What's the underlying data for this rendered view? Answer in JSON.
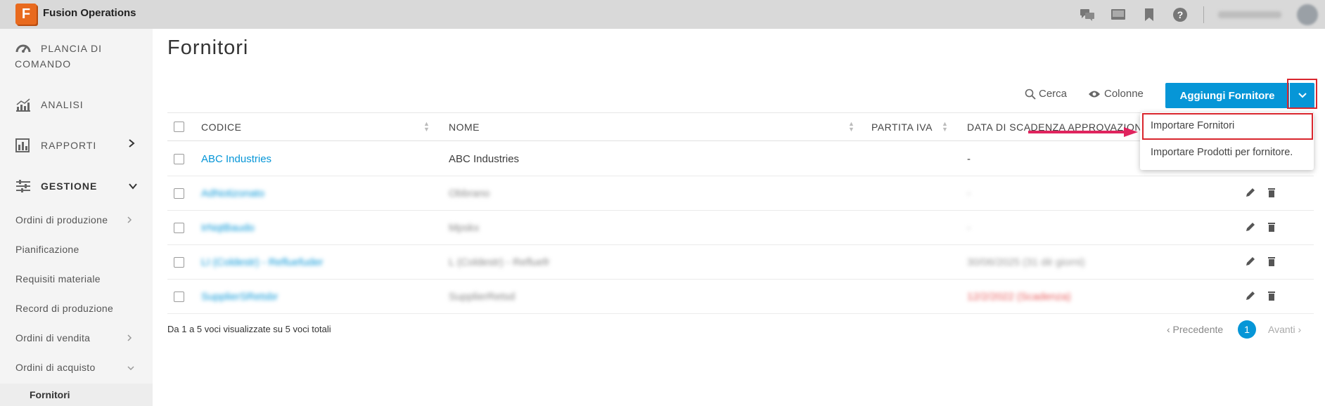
{
  "app": {
    "logo_letter": "F",
    "title": "Fusion Operations",
    "accent": "#0696d7",
    "logo_color": "#e86a1e"
  },
  "topbar": {
    "icons": [
      "chat-icon",
      "screen-icon",
      "bookmark-icon",
      "help-icon"
    ]
  },
  "sidebar": {
    "plancia_line1": "PLANCIA DI",
    "plancia_line2": "COMANDO",
    "analisi": "ANALISI",
    "rapporti": "RAPPORTI",
    "gestione": "GESTIONE",
    "sub": {
      "ordini_produzione": "Ordini di produzione",
      "pianificazione": "Pianificazione",
      "requisiti": "Requisiti materiale",
      "record": "Record di produzione",
      "ordini_vendita": "Ordini di vendita",
      "ordini_acquisto": "Ordini di acquisto",
      "fornitori": "Fornitori"
    }
  },
  "page": {
    "title": "Fornitori"
  },
  "toolbar": {
    "search": "Cerca",
    "columns": "Colonne",
    "add_button": "Aggiungi Fornitore"
  },
  "table": {
    "headers": {
      "codice": "CODICE",
      "nome": "NOME",
      "partita_iva": "PARTITA IVA",
      "scadenza": "DATA DI SCADENZA APPROVAZIONE FORNITORE"
    },
    "rows": [
      {
        "code": "ABC Industries",
        "name": "ABC Industries",
        "date": "-"
      },
      {
        "code": "AdNotizonato",
        "name": "Obbrano",
        "date": "-"
      },
      {
        "code": "IrNqtBaudo",
        "name": "Mpskx",
        "date": "-"
      },
      {
        "code": "LI (Coldestr) - Refluefuder",
        "name": "L (Coldestr) - Refluefr",
        "date": "30/06/2025 (31 dè giorni)"
      },
      {
        "code": "SupplierSRetsbr",
        "name": "SupplierRetsd",
        "date": "12/2/2022 (Scadenza)"
      }
    ]
  },
  "footer": {
    "info": "Da 1 a 5 voci visualizzate su 5 voci totali",
    "prev": "‹ Precedente",
    "page": "1",
    "next": "Avanti ›"
  },
  "dropdown": {
    "item1": "Importare Fornitori",
    "item2": "Importare Prodotti per fornitore."
  }
}
